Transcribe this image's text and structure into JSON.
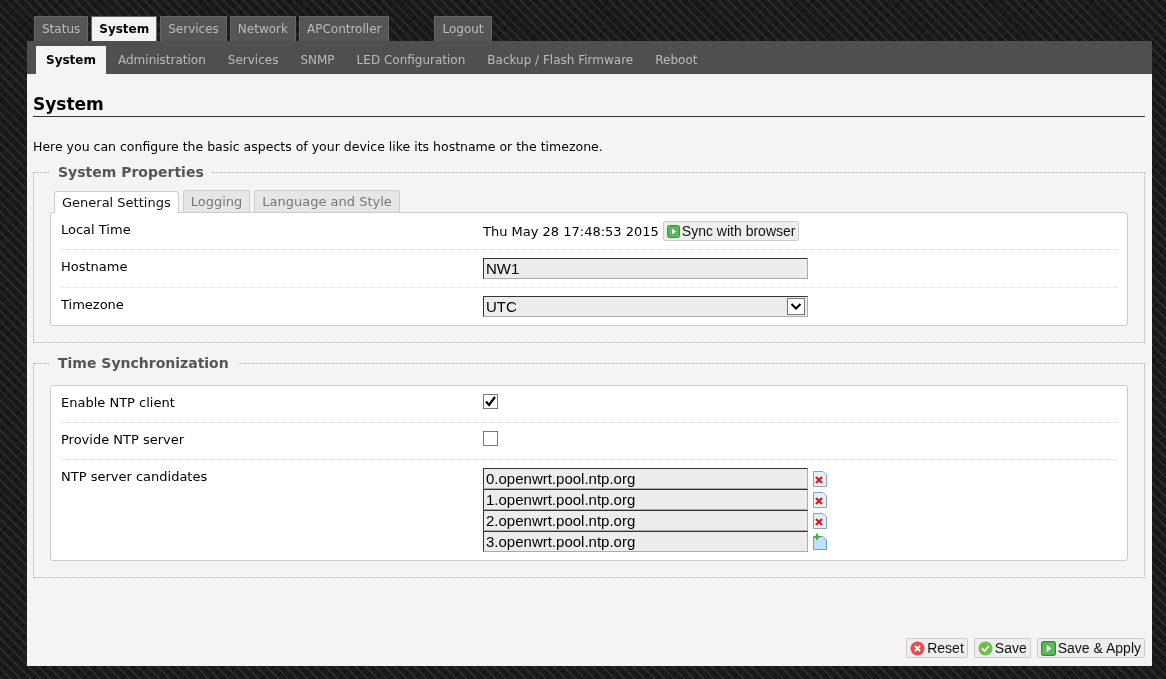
{
  "main_tabs": [
    {
      "label": "Status",
      "selected": false
    },
    {
      "label": "System",
      "selected": true
    },
    {
      "label": "Services",
      "selected": false
    },
    {
      "label": "Network",
      "selected": false
    },
    {
      "label": "APController",
      "selected": false
    }
  ],
  "logout": "Logout",
  "sub_tabs": [
    {
      "label": "System",
      "selected": true
    },
    {
      "label": "Administration",
      "selected": false
    },
    {
      "label": "Services",
      "selected": false
    },
    {
      "label": "SNMP",
      "selected": false
    },
    {
      "label": "LED Configuration",
      "selected": false
    },
    {
      "label": "Backup / Flash Firmware",
      "selected": false
    },
    {
      "label": "Reboot",
      "selected": false
    }
  ],
  "page": {
    "title": "System",
    "description": "Here you can configure the basic aspects of your device like its hostname or the timezone."
  },
  "sections": [
    {
      "legend": "System Properties",
      "tabs": [
        {
          "label": "General Settings",
          "selected": true
        },
        {
          "label": "Logging",
          "selected": false
        },
        {
          "label": "Language and Style",
          "selected": false
        }
      ],
      "rows": [
        {
          "kind": "time",
          "label": "Local Time",
          "value": "Thu May 28 17:48:53 2015",
          "button": "Sync with browser"
        },
        {
          "kind": "input",
          "label": "Hostname",
          "value": "NW1"
        },
        {
          "kind": "select",
          "label": "Timezone",
          "value": "UTC"
        }
      ]
    },
    {
      "legend": "Time Synchronization",
      "rows": [
        {
          "kind": "checkbox",
          "label": "Enable NTP client",
          "checked": true
        },
        {
          "kind": "checkbox",
          "label": "Provide NTP server",
          "checked": false
        },
        {
          "kind": "list",
          "label": "NTP server candidates",
          "items": [
            {
              "value": "0.openwrt.pool.ntp.org",
              "kind": "remove"
            },
            {
              "value": "1.openwrt.pool.ntp.org",
              "kind": "remove"
            },
            {
              "value": "2.openwrt.pool.ntp.org",
              "kind": "remove"
            },
            {
              "value": "3.openwrt.pool.ntp.org",
              "kind": "add"
            }
          ]
        }
      ]
    }
  ],
  "buttons": [
    {
      "label": "Reset",
      "kind": "reset"
    },
    {
      "label": "Save",
      "kind": "save"
    },
    {
      "label": "Save & Apply",
      "kind": "apply"
    }
  ]
}
